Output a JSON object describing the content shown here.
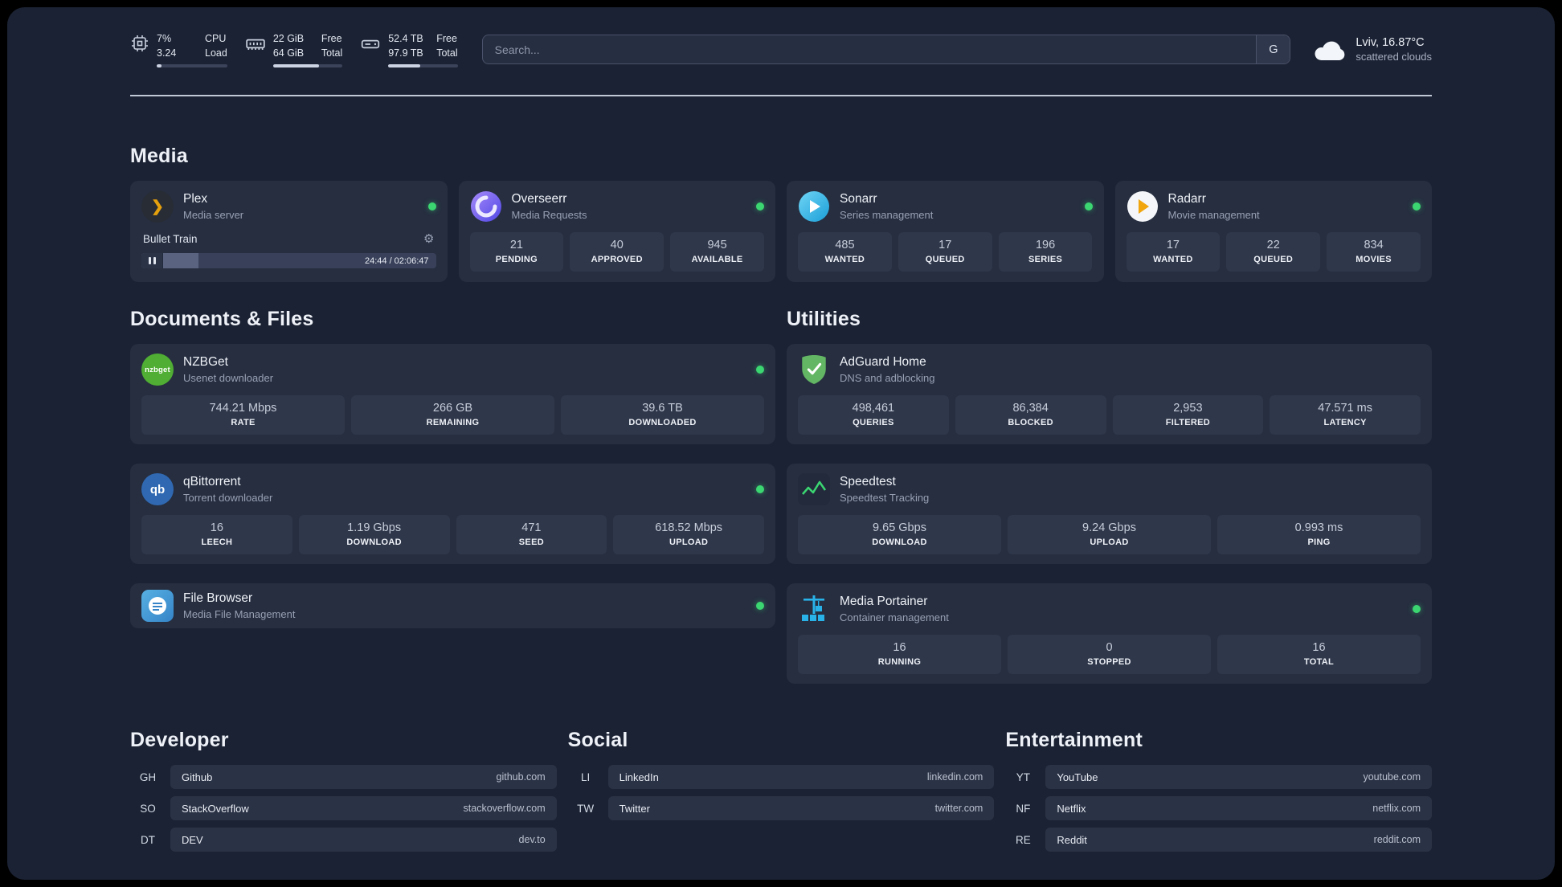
{
  "colors": {
    "background": "#1b2233",
    "card": "#262e40",
    "stat_box": "#2f374a",
    "status_online": "#3bd671",
    "plex_amber": "#e5a00d",
    "adguard_green": "#63b663",
    "portainer_blue": "#29b2e8"
  },
  "icons": {
    "gear": "⚙"
  },
  "topbar": {
    "cpu": {
      "value1": "7%",
      "value2": "3.24",
      "label1": "CPU",
      "label2": "Load",
      "fill": "7%"
    },
    "ram": {
      "value1": "22 GiB",
      "value2": "64 GiB",
      "label1": "Free",
      "label2": "Total",
      "fill": "66%"
    },
    "disk": {
      "value1": "52.4 TB",
      "value2": "97.9 TB",
      "label1": "Free",
      "label2": "Total",
      "fill": "46%"
    },
    "search": {
      "placeholder": "Search...",
      "engine_button": "G"
    },
    "weather": {
      "location": "Lviv, 16.87°C",
      "condition": "scattered clouds"
    }
  },
  "media": {
    "title": "Media",
    "plex": {
      "name": "Plex",
      "desc": "Media server",
      "now_playing": "Bullet Train",
      "time": "24:44 / 02:06:47",
      "progress": "19.5%"
    },
    "overseerr": {
      "name": "Overseerr",
      "desc": "Media Requests",
      "stats": [
        {
          "value": "21",
          "label": "PENDING"
        },
        {
          "value": "40",
          "label": "APPROVED"
        },
        {
          "value": "945",
          "label": "AVAILABLE"
        }
      ]
    },
    "sonarr": {
      "name": "Sonarr",
      "desc": "Series management",
      "stats": [
        {
          "value": "485",
          "label": "WANTED"
        },
        {
          "value": "17",
          "label": "QUEUED"
        },
        {
          "value": "196",
          "label": "SERIES"
        }
      ]
    },
    "radarr": {
      "name": "Radarr",
      "desc": "Movie management",
      "stats": [
        {
          "value": "17",
          "label": "WANTED"
        },
        {
          "value": "22",
          "label": "QUEUED"
        },
        {
          "value": "834",
          "label": "MOVIES"
        }
      ]
    }
  },
  "documents": {
    "title": "Documents & Files",
    "nzbget": {
      "name": "NZBGet",
      "desc": "Usenet downloader",
      "icon_text": "nzbget",
      "stats": [
        {
          "value": "744.21 Mbps",
          "label": "RATE"
        },
        {
          "value": "266 GB",
          "label": "REMAINING"
        },
        {
          "value": "39.6 TB",
          "label": "DOWNLOADED"
        }
      ]
    },
    "qbittorrent": {
      "name": "qBittorrent",
      "desc": "Torrent downloader",
      "icon_text": "qb",
      "stats": [
        {
          "value": "16",
          "label": "LEECH"
        },
        {
          "value": "1.19 Gbps",
          "label": "DOWNLOAD"
        },
        {
          "value": "471",
          "label": "SEED"
        },
        {
          "value": "618.52 Mbps",
          "label": "UPLOAD"
        }
      ]
    },
    "filebrowser": {
      "name": "File Browser",
      "desc": "Media File Management"
    }
  },
  "utilities": {
    "title": "Utilities",
    "adguard": {
      "name": "AdGuard Home",
      "desc": "DNS and adblocking",
      "stats": [
        {
          "value": "498,461",
          "label": "QUERIES"
        },
        {
          "value": "86,384",
          "label": "BLOCKED"
        },
        {
          "value": "2,953",
          "label": "FILTERED"
        },
        {
          "value": "47.571 ms",
          "label": "LATENCY"
        }
      ]
    },
    "speedtest": {
      "name": "Speedtest",
      "desc": "Speedtest Tracking",
      "stats": [
        {
          "value": "9.65 Gbps",
          "label": "DOWNLOAD"
        },
        {
          "value": "9.24 Gbps",
          "label": "UPLOAD"
        },
        {
          "value": "0.993 ms",
          "label": "PING"
        }
      ]
    },
    "portainer": {
      "name": "Media Portainer",
      "desc": "Container management",
      "stats": [
        {
          "value": "16",
          "label": "RUNNING"
        },
        {
          "value": "0",
          "label": "STOPPED"
        },
        {
          "value": "16",
          "label": "TOTAL"
        }
      ]
    }
  },
  "bookmarks": {
    "developer": {
      "title": "Developer",
      "items": [
        {
          "abbr": "GH",
          "name": "Github",
          "url": "github.com"
        },
        {
          "abbr": "SO",
          "name": "StackOverflow",
          "url": "stackoverflow.com"
        },
        {
          "abbr": "DT",
          "name": "DEV",
          "url": "dev.to"
        }
      ]
    },
    "social": {
      "title": "Social",
      "items": [
        {
          "abbr": "LI",
          "name": "LinkedIn",
          "url": "linkedin.com"
        },
        {
          "abbr": "TW",
          "name": "Twitter",
          "url": "twitter.com"
        }
      ]
    },
    "entertainment": {
      "title": "Entertainment",
      "items": [
        {
          "abbr": "YT",
          "name": "YouTube",
          "url": "youtube.com"
        },
        {
          "abbr": "NF",
          "name": "Netflix",
          "url": "netflix.com"
        },
        {
          "abbr": "RE",
          "name": "Reddit",
          "url": "reddit.com"
        }
      ]
    }
  }
}
